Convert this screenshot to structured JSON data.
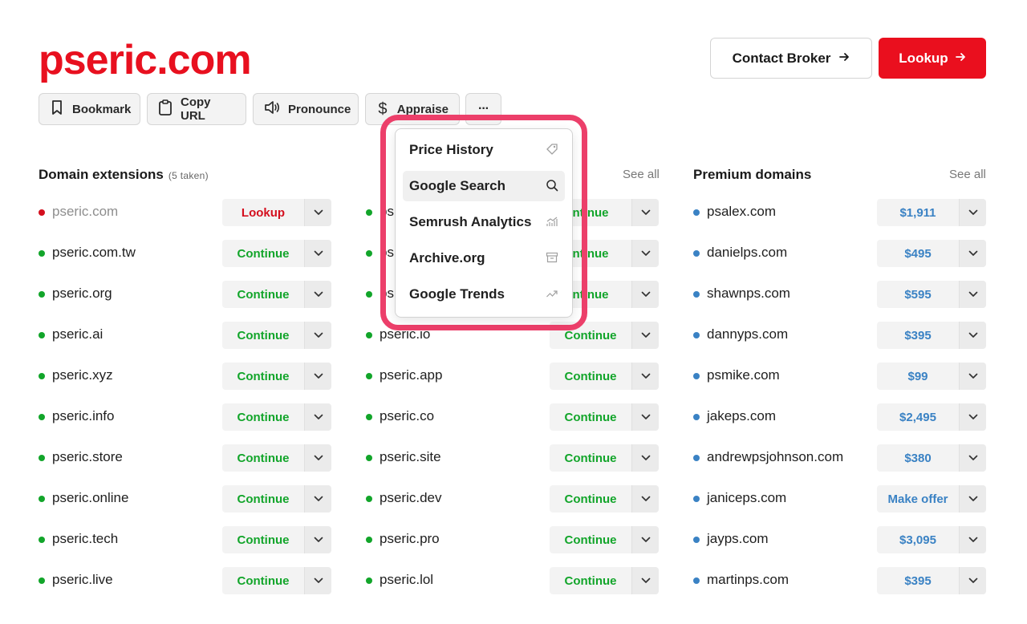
{
  "domain_title": "pseric.com",
  "header": {
    "contact_label": "Contact Broker",
    "lookup_label": "Lookup",
    "arrow": "→"
  },
  "actions": {
    "bookmark": "Bookmark",
    "copy_url": "Copy URL",
    "pronounce": "Pronounce",
    "appraise": "Appraise",
    "more": "···"
  },
  "sections": {
    "extensions_title": "Domain extensions",
    "extensions_taken": "(5 taken)",
    "see_all_1": "See all",
    "premium_title": "Premium domains",
    "see_all_2": "See all"
  },
  "extensions_col1": [
    {
      "name": "pseric.com",
      "action": "Lookup",
      "status": "taken"
    },
    {
      "name": "pseric.com.tw",
      "action": "Continue"
    },
    {
      "name": "pseric.org",
      "action": "Continue"
    },
    {
      "name": "pseric.ai",
      "action": "Continue"
    },
    {
      "name": "pseric.xyz",
      "action": "Continue"
    },
    {
      "name": "pseric.info",
      "action": "Continue"
    },
    {
      "name": "pseric.store",
      "action": "Continue"
    },
    {
      "name": "pseric.online",
      "action": "Continue"
    },
    {
      "name": "pseric.tech",
      "action": "Continue"
    },
    {
      "name": "pseric.live",
      "action": "Continue"
    }
  ],
  "extensions_col2": [
    {
      "name": "ps",
      "action": "ntinue"
    },
    {
      "name": "ps",
      "action": "ntinue"
    },
    {
      "name": "ps",
      "action": "ntinue"
    },
    {
      "name": "pseric.io",
      "action": "Continue"
    },
    {
      "name": "pseric.app",
      "action": "Continue"
    },
    {
      "name": "pseric.co",
      "action": "Continue"
    },
    {
      "name": "pseric.site",
      "action": "Continue"
    },
    {
      "name": "pseric.dev",
      "action": "Continue"
    },
    {
      "name": "pseric.pro",
      "action": "Continue"
    },
    {
      "name": "pseric.lol",
      "action": "Continue"
    }
  ],
  "premium": [
    {
      "name": "psalex.com",
      "price": "$1,911"
    },
    {
      "name": "danielps.com",
      "price": "$495"
    },
    {
      "name": "shawnps.com",
      "price": "$595"
    },
    {
      "name": "dannyps.com",
      "price": "$395"
    },
    {
      "name": "psmike.com",
      "price": "$99"
    },
    {
      "name": "jakeps.com",
      "price": "$2,495"
    },
    {
      "name": "andrewpsjohnson.com",
      "price": "$380"
    },
    {
      "name": "janiceps.com",
      "price": "Make offer"
    },
    {
      "name": "jayps.com",
      "price": "$3,095"
    },
    {
      "name": "martinps.com",
      "price": "$395"
    }
  ],
  "dropdown": {
    "items": [
      {
        "label": "Price History",
        "icon": "price-tag-icon"
      },
      {
        "label": "Google Search",
        "icon": "search-icon"
      },
      {
        "label": "Semrush Analytics",
        "icon": "analytics-icon"
      },
      {
        "label": "Archive.org",
        "icon": "archive-icon"
      },
      {
        "label": "Google Trends",
        "icon": "trends-icon"
      }
    ]
  },
  "colors": {
    "brand_red": "#e8101f",
    "available_green": "#12a52a",
    "premium_blue": "#3a82c4",
    "taken_red": "#d40f1e",
    "highlight_pink": "#ec3f6a"
  }
}
